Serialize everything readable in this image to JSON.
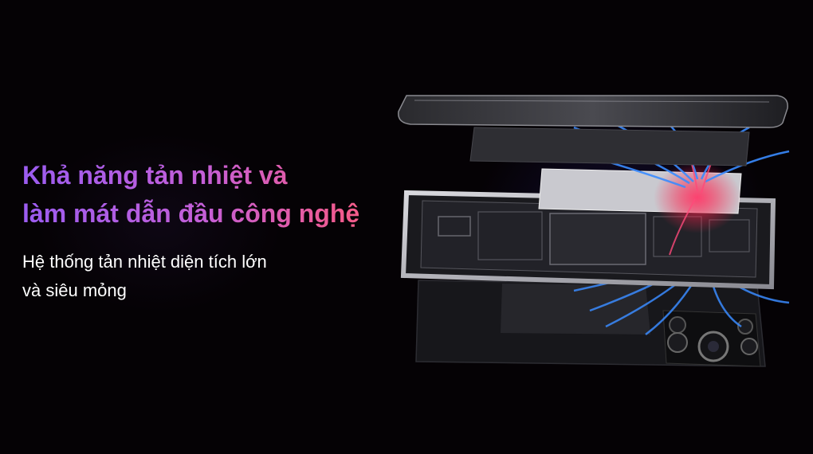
{
  "headline": {
    "line1": "Khả năng tản nhiệt và",
    "line2": "làm mát dẫn đầu công nghệ"
  },
  "subtitle": {
    "line1": "Hệ thống tản nhiệt diện tích lớn",
    "line2": "và siêu mỏng"
  },
  "illustration": {
    "subject": "exploded-phone-cooling-layers",
    "colors": {
      "heat": "#ff2a55",
      "airflow": "#3a8bff",
      "background": "#050205"
    }
  }
}
